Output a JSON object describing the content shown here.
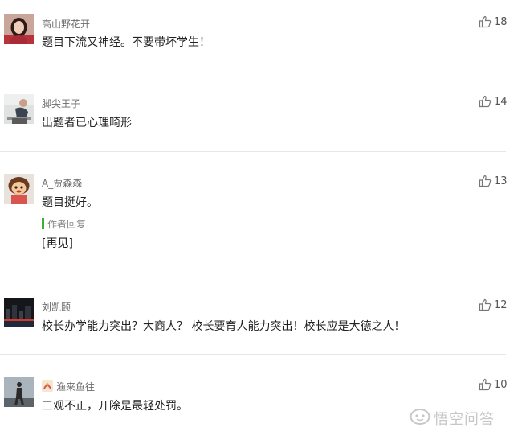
{
  "comments": [
    {
      "username": "高山野花开",
      "text": "题目下流又神经。不要带坏学生！",
      "likes": "18",
      "avatar": "woman-portrait"
    },
    {
      "username": "脚尖王子",
      "text": "出题者已心理畸形",
      "likes": "14",
      "avatar": "person-sitting"
    },
    {
      "username": "A_贾森森",
      "text": "题目挺好。",
      "likes": "13",
      "avatar": "cartoon-doll",
      "reply": {
        "label": "作者回复",
        "text": "[再见]"
      }
    },
    {
      "username": "刘凯颐",
      "text": "校长办学能力突出？大商人？ 校长要育人能力突出！校长应是大德之人！",
      "likes": "12",
      "avatar": "night-city"
    },
    {
      "username": "渔来鱼往",
      "text": "三观不正，开除是最轻处罚。",
      "likes": "10",
      "avatar": "silhouette-figure"
    }
  ],
  "watermark": {
    "text": "悟空问答",
    "icon": "wukong-logo"
  },
  "colors": {
    "reply_accent": "#3cb034",
    "divider": "#e6e6e6",
    "username": "#6b6b6b",
    "text": "#222222"
  }
}
